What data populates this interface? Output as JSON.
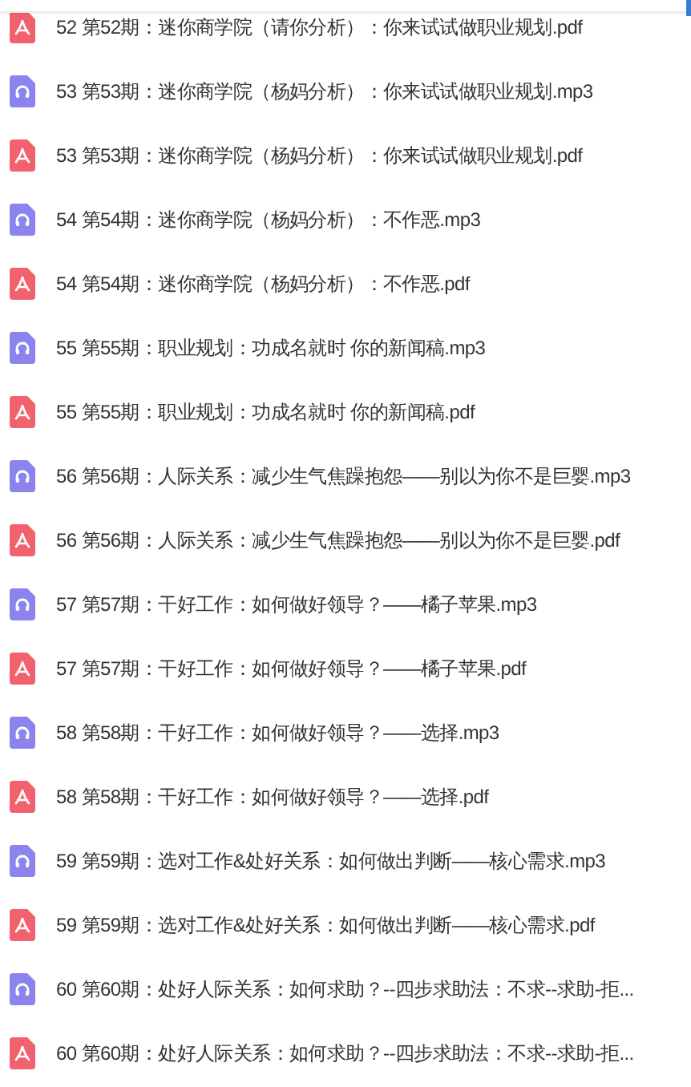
{
  "files": [
    {
      "kind": "pdf",
      "name": "52 第52期：迷你商学院（请你分析）：你来试试做职业规划.pdf"
    },
    {
      "kind": "audio",
      "name": "53 第53期：迷你商学院（杨妈分析）：你来试试做职业规划.mp3"
    },
    {
      "kind": "pdf",
      "name": "53 第53期：迷你商学院（杨妈分析）：你来试试做职业规划.pdf"
    },
    {
      "kind": "audio",
      "name": "54 第54期：迷你商学院（杨妈分析）：不作恶.mp3"
    },
    {
      "kind": "pdf",
      "name": "54 第54期：迷你商学院（杨妈分析）：不作恶.pdf"
    },
    {
      "kind": "audio",
      "name": "55 第55期：职业规划：功成名就时 你的新闻稿.mp3"
    },
    {
      "kind": "pdf",
      "name": "55 第55期：职业规划：功成名就时 你的新闻稿.pdf"
    },
    {
      "kind": "audio",
      "name": "56 第56期：人际关系：减少生气焦躁抱怨——别以为你不是巨婴.mp3"
    },
    {
      "kind": "pdf",
      "name": "56 第56期：人际关系：减少生气焦躁抱怨——别以为你不是巨婴.pdf"
    },
    {
      "kind": "audio",
      "name": "57 第57期：干好工作：如何做好领导？——橘子苹果.mp3"
    },
    {
      "kind": "pdf",
      "name": "57 第57期：干好工作：如何做好领导？——橘子苹果.pdf"
    },
    {
      "kind": "audio",
      "name": "58 第58期：干好工作：如何做好领导？——选择.mp3"
    },
    {
      "kind": "pdf",
      "name": "58 第58期：干好工作：如何做好领导？——选择.pdf"
    },
    {
      "kind": "audio",
      "name": "59 第59期：选对工作&处好关系：如何做出判断——核心需求.mp3"
    },
    {
      "kind": "pdf",
      "name": "59 第59期：选对工作&处好关系：如何做出判断——核心需求.pdf"
    },
    {
      "kind": "audio",
      "name": "60 第60期：处好人际关系：如何求助？--四步求助法：不求--求助-拒..."
    },
    {
      "kind": "pdf",
      "name": "60 第60期：处好人际关系：如何求助？--四步求助法：不求--求助-拒..."
    }
  ]
}
